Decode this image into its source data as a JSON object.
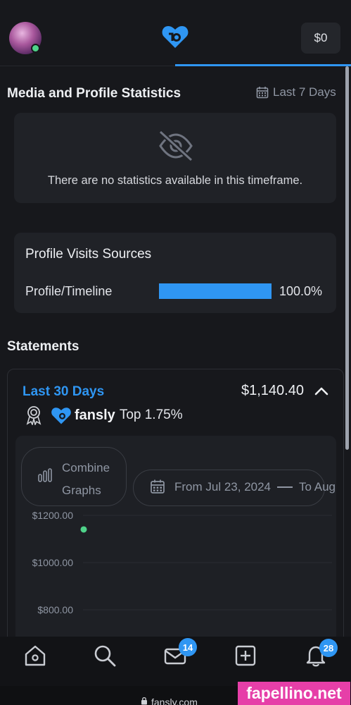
{
  "header": {
    "balance": "$0",
    "avatar_status": "online",
    "brand_color": "#2f96f3"
  },
  "media_stats": {
    "title": "Media and Profile Statistics",
    "range_label": "Last 7 Days",
    "empty_message": "There are no statistics available in this timeframe."
  },
  "profile_visits": {
    "title": "Profile Visits Sources",
    "sources": [
      {
        "label": "Profile/Timeline",
        "percent_text": "100.0%",
        "fraction": 1.0
      }
    ]
  },
  "statements": {
    "title": "Statements",
    "period_label": "Last 30 Days",
    "amount": "$1,140.40",
    "brand_word": "fansly",
    "rank_text": "Top 1.75%",
    "combine_label": "Combine Graphs",
    "date_from": "From Jul 23, 2024",
    "date_to": "To Aug"
  },
  "chart_data": {
    "type": "scatter",
    "y_ticks": [
      "$1200.00",
      "$1000.00",
      "$800.00"
    ],
    "y_tick_values": [
      1200,
      1000,
      800
    ],
    "points": [
      {
        "y": 1140.4,
        "color": "#4fd38a"
      }
    ]
  },
  "bottom_nav": {
    "items": [
      {
        "name": "home",
        "badge": ""
      },
      {
        "name": "search",
        "badge": ""
      },
      {
        "name": "messages",
        "badge": "14"
      },
      {
        "name": "create",
        "badge": ""
      },
      {
        "name": "notifications",
        "badge": "28"
      }
    ]
  },
  "browser": {
    "url": "fansly.com"
  },
  "watermark": "fapellino.net"
}
